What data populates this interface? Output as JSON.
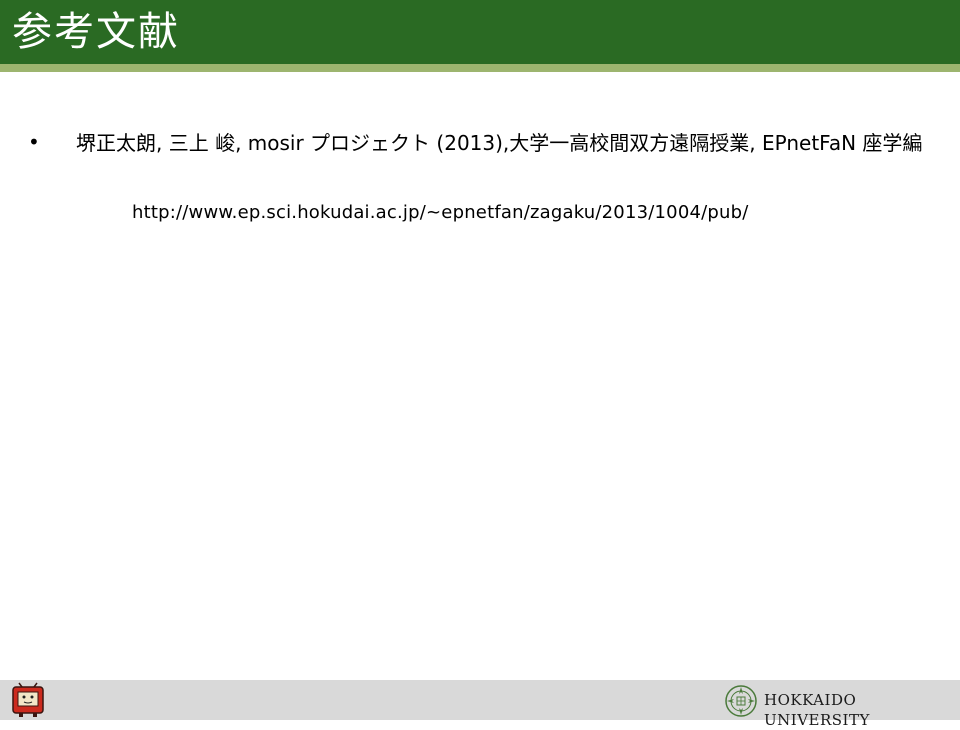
{
  "slide": {
    "title": "参考文献"
  },
  "references": [
    {
      "bullet": "•",
      "text": "堺正太朗, 三上 峻, mosir プロジェクト (2013),大学一高校間双方遠隔授業, EPnetFaN 座学編",
      "url": "http://www.ep.sci.hokudai.ac.jp/~epnetfan/zagaku/2013/1004/pub/"
    }
  ],
  "footer": {
    "university_name": "HOKKAIDO UNIVERSITY",
    "mascot_icon": "mascot-tv-icon",
    "logo_icon": "hokkaido-university-emblem-icon"
  },
  "colors": {
    "title_bar": "#2a6a23",
    "title_rule": "#9db56f",
    "footer_bar": "#d9d9d9",
    "mascot_accent": "#cc2a1e"
  }
}
